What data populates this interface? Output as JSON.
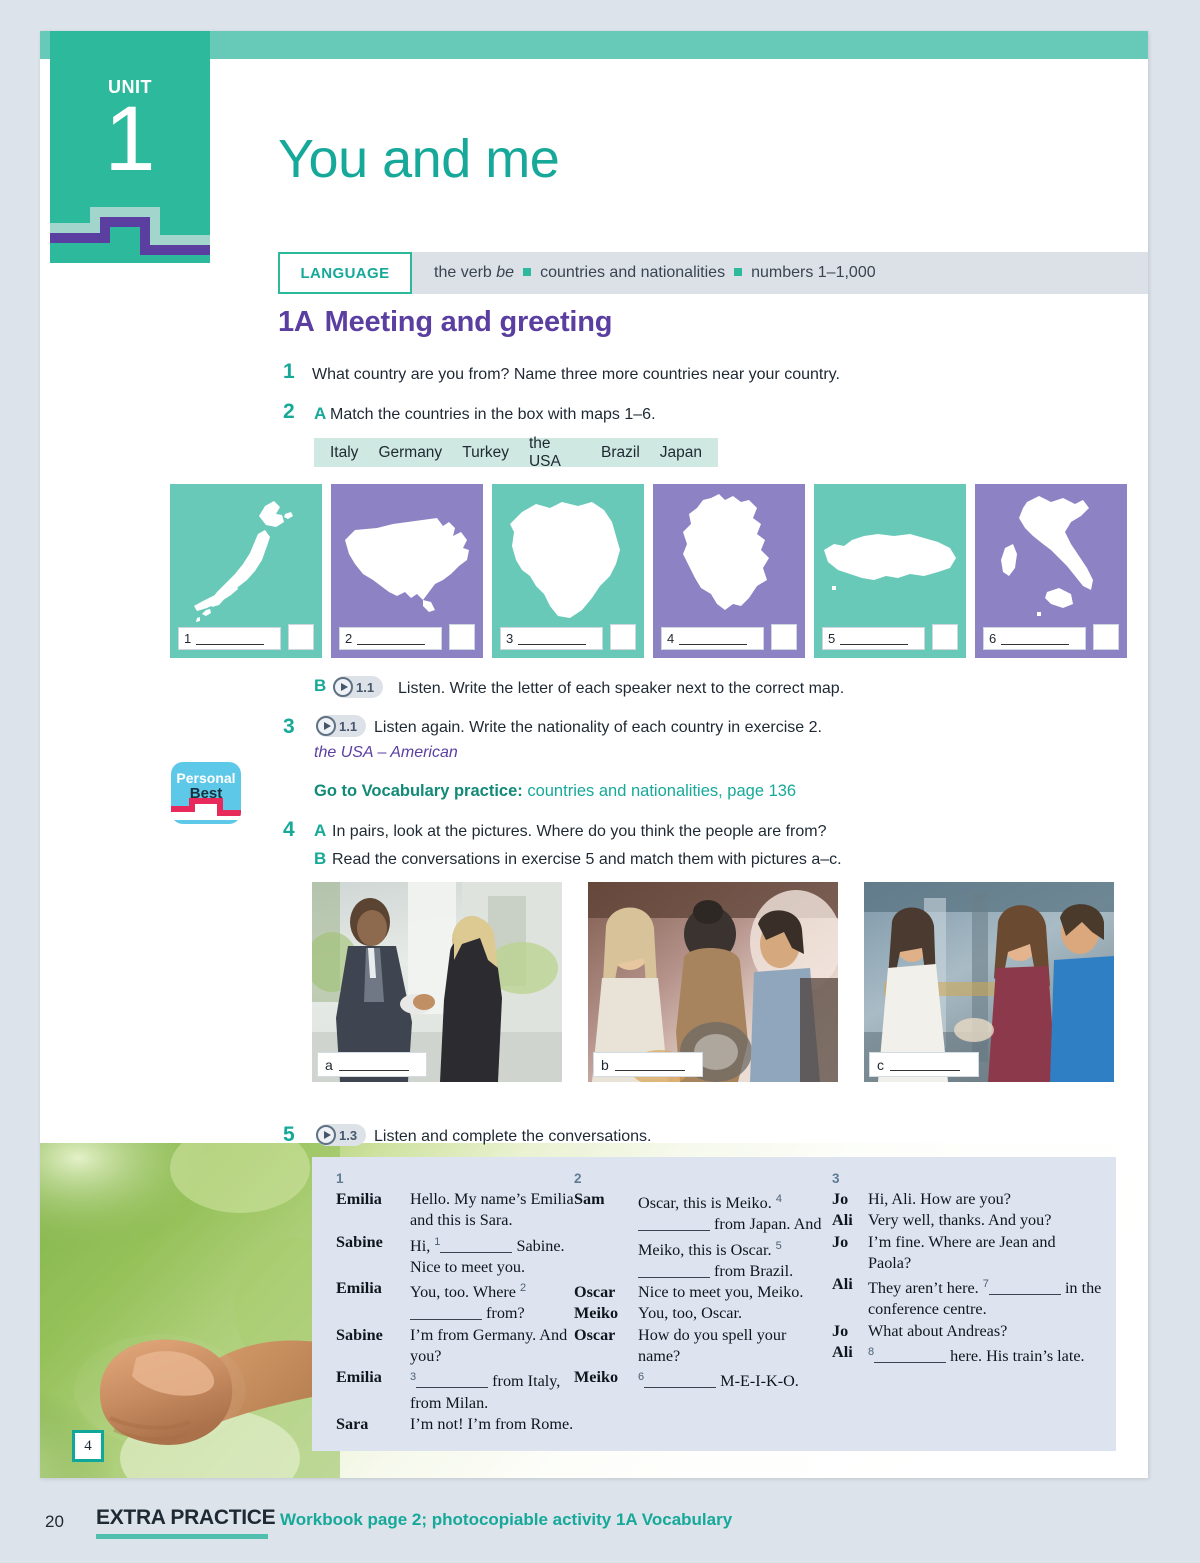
{
  "unit": {
    "word": "UNIT",
    "number": "1",
    "title": "You and me"
  },
  "language_bar": {
    "chip": "LANGUAGE",
    "items": [
      "the verb be",
      "countries and nationalities",
      "numbers 1–1,000"
    ],
    "verb_plain": "the verb ",
    "verb_italic": "be"
  },
  "section": {
    "code": "1A",
    "heading": "Meeting and greeting"
  },
  "exercises": {
    "e1": {
      "num": "1",
      "text": "What country are you from? Name three more countries near your country."
    },
    "e2a": {
      "num": "2",
      "letter": "A",
      "text": "Match the countries in the box with maps 1–6."
    },
    "e2b": {
      "letter": "B",
      "track": "1.1",
      "text": "Listen. Write the letter of each speaker next to the correct map."
    },
    "e3": {
      "num": "3",
      "track": "1.1",
      "text": "Listen again. Write the nationality of each country in exercise 2.",
      "example": "the USA – American"
    },
    "e4a": {
      "num": "4",
      "letter": "A",
      "text": "In pairs, look at the pictures. Where do you think the people are from?"
    },
    "e4b": {
      "letter": "B",
      "text": "Read the conversations in exercise 5 and match them with pictures a–c."
    },
    "e5": {
      "num": "5",
      "track": "1.3",
      "text": "Listen and complete the conversations."
    }
  },
  "wordbox": [
    "Italy",
    "Germany",
    "Turkey",
    "the USA",
    "Brazil",
    "Japan"
  ],
  "maps": [
    {
      "number": "1",
      "country": "Japan",
      "color": "teal"
    },
    {
      "number": "2",
      "country": "the USA",
      "color": "purple"
    },
    {
      "number": "3",
      "country": "Brazil",
      "color": "teal"
    },
    {
      "number": "4",
      "country": "Germany",
      "color": "purple"
    },
    {
      "number": "5",
      "country": "Turkey",
      "color": "teal"
    },
    {
      "number": "6",
      "country": "Italy",
      "color": "purple"
    }
  ],
  "vocab_link": {
    "bold": "Go to Vocabulary practice:",
    "rest": " countries and nationalities, page 136"
  },
  "personal_best": {
    "line1": "Personal",
    "line2": "Best"
  },
  "photos": [
    {
      "label": "a",
      "alt": "businessman and woman shaking hands outside office"
    },
    {
      "label": "b",
      "alt": "group of young people at a market stall"
    },
    {
      "label": "c",
      "alt": "three people talking in a workshop"
    }
  ],
  "conversations": [
    {
      "number": "1",
      "lines": [
        {
          "speaker": "Emilia",
          "parts": [
            {
              "t": "text",
              "v": "Hello. My name’s Emilia and this is Sara."
            }
          ]
        },
        {
          "speaker": "Sabine",
          "parts": [
            {
              "t": "text",
              "v": "Hi, "
            },
            {
              "t": "blank",
              "v": "1"
            },
            {
              "t": "text",
              "v": " Sabine. Nice to meet you."
            }
          ]
        },
        {
          "speaker": "Emilia",
          "parts": [
            {
              "t": "text",
              "v": "You, too. Where "
            },
            {
              "t": "blank",
              "v": "2"
            },
            {
              "t": "text",
              "v": " from?"
            }
          ]
        },
        {
          "speaker": "Sabine",
          "parts": [
            {
              "t": "text",
              "v": "I’m from Germany. And you?"
            }
          ]
        },
        {
          "speaker": "Emilia",
          "parts": [
            {
              "t": "blank",
              "v": "3"
            },
            {
              "t": "text",
              "v": " from Italy, from Milan."
            }
          ]
        },
        {
          "speaker": "Sara",
          "parts": [
            {
              "t": "text",
              "v": "I’m not! I’m from Rome."
            }
          ]
        }
      ]
    },
    {
      "number": "2",
      "lines": [
        {
          "speaker": "Sam",
          "parts": [
            {
              "t": "text",
              "v": "Oscar, this is Meiko. "
            },
            {
              "t": "blank",
              "v": "4"
            },
            {
              "t": "text",
              "v": " from Japan. And Meiko, this is Oscar. "
            },
            {
              "t": "blank",
              "v": "5"
            },
            {
              "t": "text",
              "v": " from Brazil."
            }
          ]
        },
        {
          "speaker": "Oscar",
          "parts": [
            {
              "t": "text",
              "v": "Nice to meet you, Meiko."
            }
          ]
        },
        {
          "speaker": "Meiko",
          "parts": [
            {
              "t": "text",
              "v": "You, too, Oscar."
            }
          ]
        },
        {
          "speaker": "Oscar",
          "parts": [
            {
              "t": "text",
              "v": "How do you spell your name?"
            }
          ]
        },
        {
          "speaker": "Meiko",
          "parts": [
            {
              "t": "blank",
              "v": "6"
            },
            {
              "t": "text",
              "v": " M-E-I-K-O."
            }
          ]
        }
      ]
    },
    {
      "number": "3",
      "lines": [
        {
          "speaker": "Jo",
          "parts": [
            {
              "t": "text",
              "v": "Hi, Ali. How are you?"
            }
          ]
        },
        {
          "speaker": "Ali",
          "parts": [
            {
              "t": "text",
              "v": "Very well, thanks. And you?"
            }
          ]
        },
        {
          "speaker": "Jo",
          "parts": [
            {
              "t": "text",
              "v": "I’m fine. Where are Jean and Paola?"
            }
          ]
        },
        {
          "speaker": "Ali",
          "parts": [
            {
              "t": "text",
              "v": "They aren’t here. "
            },
            {
              "t": "blank",
              "v": "7"
            },
            {
              "t": "text",
              "v": " in the conference centre."
            }
          ]
        },
        {
          "speaker": "Jo",
          "parts": [
            {
              "t": "text",
              "v": "What about Andreas?"
            }
          ]
        },
        {
          "speaker": "Ali",
          "parts": [
            {
              "t": "blank",
              "v": "8"
            },
            {
              "t": "text",
              "v": " here. His train’s late."
            }
          ]
        }
      ]
    }
  ],
  "page_badge": "4",
  "footer": {
    "page_number": "20",
    "label": "EXTRA PRACTICE",
    "text": "Workbook page 2; photocopiable activity 1A Vocabulary"
  },
  "colors": {
    "teal": "#2db99b",
    "teal_light": "#69c9b8",
    "purple": "#5b3fa0",
    "map_purple": "#8c82c4",
    "panel_blue": "#dde4ef",
    "lang_bg": "#dce1e8"
  }
}
